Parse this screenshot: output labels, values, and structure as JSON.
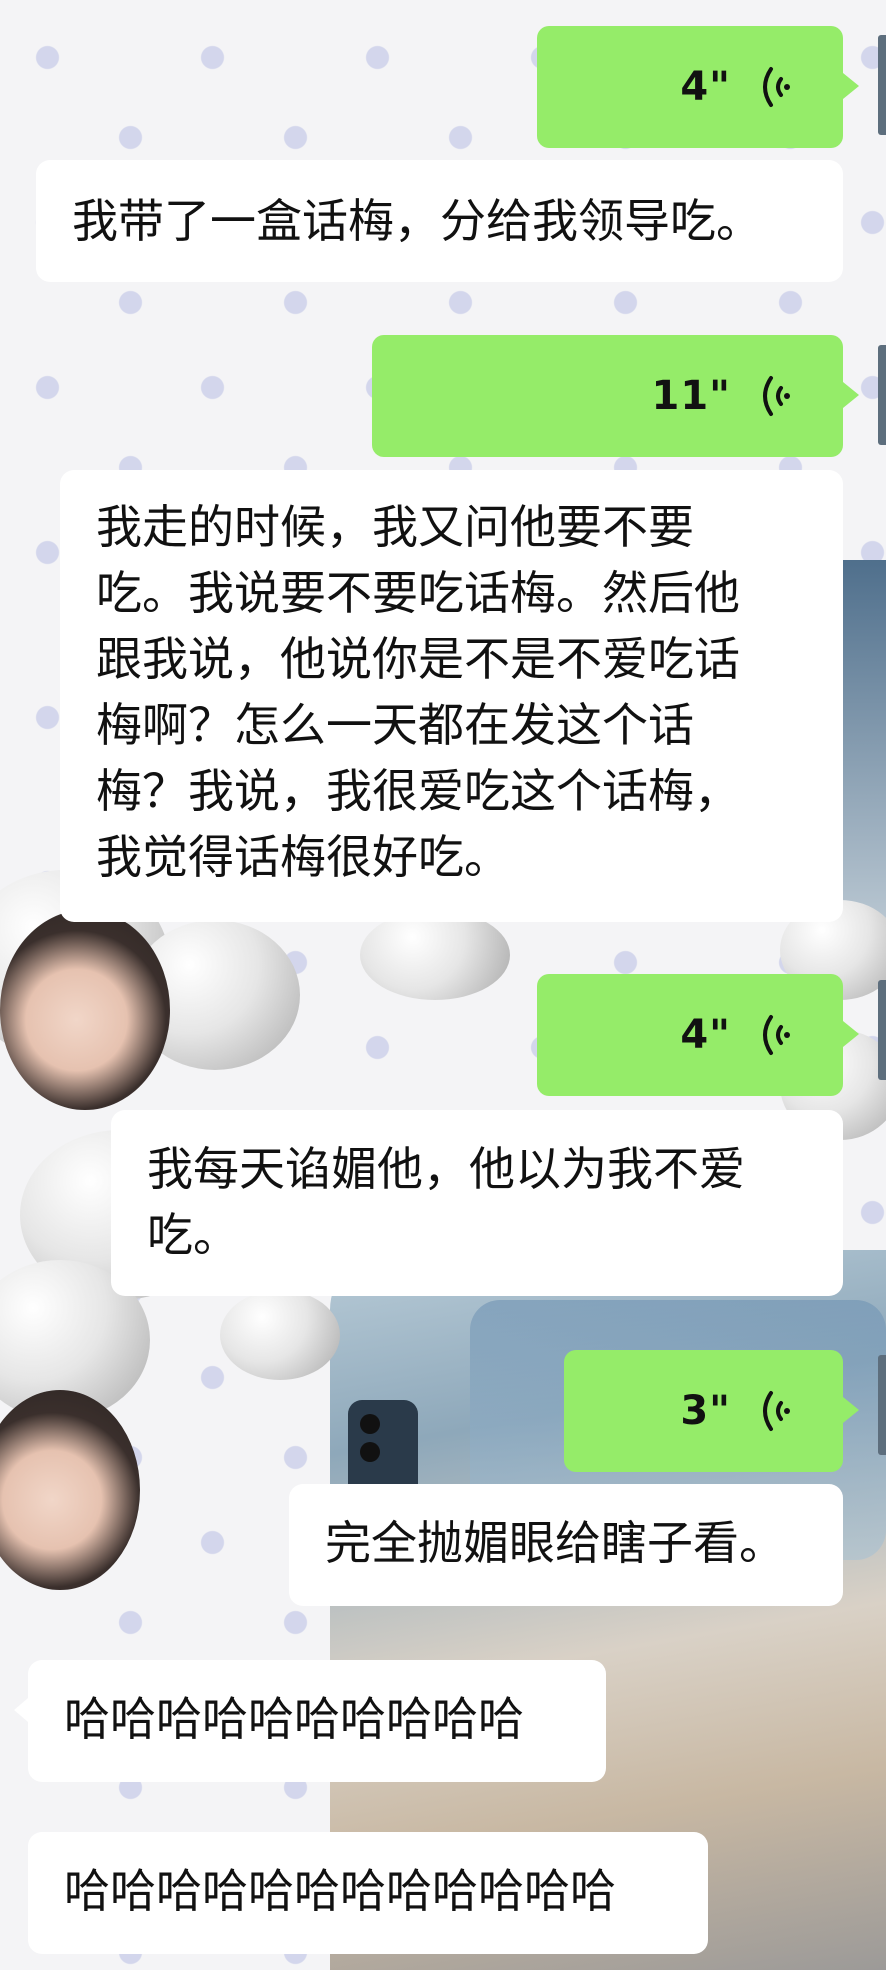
{
  "colors": {
    "outgoing_bubble": "#95ec69",
    "incoming_bubble": "#ffffff",
    "background": "#f4f4f6"
  },
  "messages": [
    {
      "type": "voice",
      "direction": "out",
      "duration": "4\"",
      "icon": "voice-wave-icon"
    },
    {
      "type": "text",
      "direction": "in",
      "lines": [
        "我带了一盒话梅，分给我领导吃。"
      ]
    },
    {
      "type": "voice",
      "direction": "out",
      "duration": "11\"",
      "icon": "voice-wave-icon"
    },
    {
      "type": "text",
      "direction": "in",
      "lines": [
        "我走的时候，我又问他要不要",
        "吃。我说要不要吃话梅。然后他",
        "跟我说，他说你是不是不爱吃话",
        "梅啊？怎么一天都在发这个话",
        "梅？我说，我很爱吃这个话梅，",
        "我觉得话梅很好吃。"
      ]
    },
    {
      "type": "voice",
      "direction": "out",
      "duration": "4\"",
      "icon": "voice-wave-icon"
    },
    {
      "type": "text",
      "direction": "in",
      "lines": [
        "我每天谄媚他，他以为我不爱",
        "吃。"
      ]
    },
    {
      "type": "voice",
      "direction": "out",
      "duration": "3\"",
      "icon": "voice-wave-icon"
    },
    {
      "type": "text",
      "direction": "in",
      "lines": [
        "完全抛媚眼给瞎子看。"
      ]
    },
    {
      "type": "text",
      "direction": "in",
      "lines": [
        "哈哈哈哈哈哈哈哈哈哈"
      ]
    },
    {
      "type": "text",
      "direction": "in",
      "lines": [
        "哈哈哈哈哈哈哈哈哈哈哈哈"
      ]
    }
  ]
}
